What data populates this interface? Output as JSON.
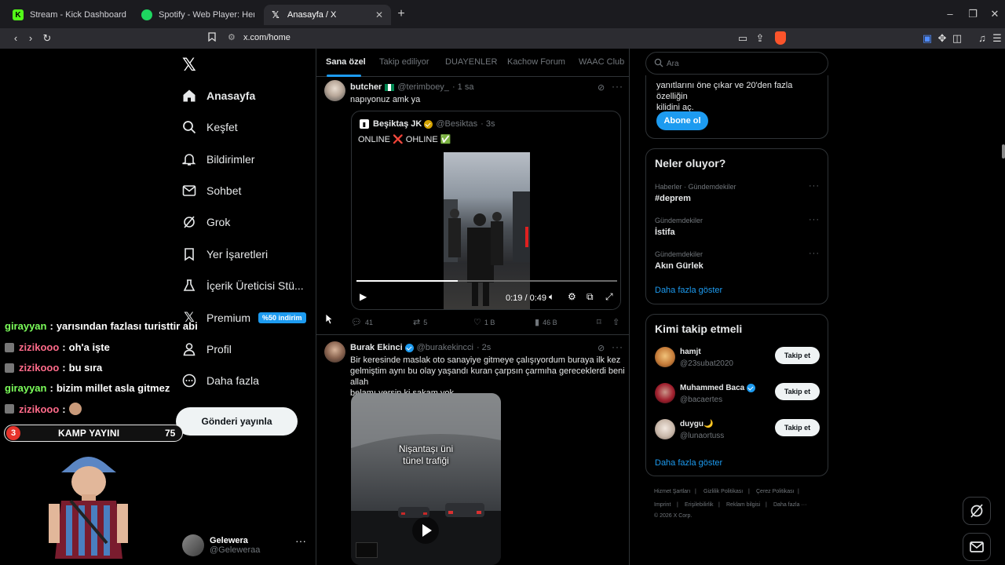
{
  "browser": {
    "tabs": [
      {
        "title": "Stream - Kick Dashboard",
        "icon": "kick-icon",
        "active": false
      },
      {
        "title": "Spotify - Web Player: Herkes için müz",
        "icon": "spotify-icon",
        "active": false
      },
      {
        "title": "Anasayfa / X",
        "icon": "x-icon",
        "active": true
      }
    ],
    "new_tab": "+",
    "url": "x.com/home",
    "colors": {
      "kick": "#53fc18",
      "spotify": "#1ed760",
      "brave": "#fb542b"
    }
  },
  "nav": {
    "items": [
      {
        "label": "Anasayfa",
        "icon": "home-icon",
        "active": true
      },
      {
        "label": "Keşfet",
        "icon": "search-icon"
      },
      {
        "label": "Bildirimler",
        "icon": "bell-icon"
      },
      {
        "label": "Sohbet",
        "icon": "mail-icon"
      },
      {
        "label": "Grok",
        "icon": "grok-icon"
      },
      {
        "label": "Yer İşaretleri",
        "icon": "bookmark-icon"
      },
      {
        "label": "İçerik Üreticisi Stü...",
        "icon": "creator-studio-icon"
      },
      {
        "label": "Premium",
        "icon": "x-icon",
        "badge": "%50 indirim"
      },
      {
        "label": "Profil",
        "icon": "person-icon"
      },
      {
        "label": "Daha fazla",
        "icon": "more-circle-icon"
      }
    ],
    "post_button": "Gönderi yayınla",
    "account": {
      "name": "Gelewera",
      "handle": "@Geleweraa",
      "more": "···"
    }
  },
  "stream_overlay": {
    "chat": [
      {
        "user": "girayyan",
        "message": "yarısından fazlası turisttir abi",
        "color": "green",
        "emote": false
      },
      {
        "user": "zizikooo",
        "message": "oh'a işte",
        "color": "pink",
        "emote": true
      },
      {
        "user": "zizikooo",
        "message": "bu sıra",
        "color": "pink",
        "emote": true
      },
      {
        "user": "girayyan",
        "message": "bizim millet asla gitmez",
        "color": "green",
        "emote": false
      },
      {
        "user": "zizikooo",
        "message": "",
        "color": "pink",
        "emote": true
      }
    ],
    "kamp": {
      "left": "3",
      "title": "KAMP YAYINI",
      "right": "75"
    }
  },
  "feed": {
    "tabs": [
      "Sana özel",
      "Takip ediliyor",
      "DUAYENLER",
      "Kachow Forum",
      "WAAC Club"
    ],
    "posts": [
      {
        "name": "butcher",
        "handle": "@terimboey_",
        "time": "· 1 sa",
        "text": "napıyonuz amk ya",
        "quote": {
          "name": "Beşiktaş JK",
          "handle": "@Besiktas",
          "time": "· 3s",
          "text": "ONLINE ❌ OHLINE ✅",
          "video_time": "0:19 / 0:49",
          "video_progress": 0.39
        },
        "actions": {
          "replies": "41",
          "reposts": "5",
          "likes": "1 B",
          "views": "46 B"
        }
      },
      {
        "name": "Burak Ekinci",
        "handle": "@burakekincci",
        "time": "· 2s",
        "text": [
          "Bir keresinde maslak oto sanayiye gitmeye çalışıyordum buraya ilk kez",
          "gelmiştim aynı bu olay yaşandı kuran çarpsın çarmıha gereceklerdi beni allah",
          "belamı versin ki şakam yok"
        ],
        "media_caption": [
          "Nişantaşı üni",
          "tünel trafiği"
        ]
      }
    ]
  },
  "right": {
    "search_placeholder": "Ara",
    "premium": {
      "text": [
        "yanıtlarını öne çıkar ve 20'den fazla özelliğin",
        "kilidini aç."
      ],
      "button": "Abone ol"
    },
    "trends": {
      "title": "Neler oluyor?",
      "items": [
        {
          "category": "Haberler · Gündemdekiler",
          "name": "#deprem"
        },
        {
          "category": "Gündemdekiler",
          "name": "İstifa"
        },
        {
          "category": "Gündemdekiler",
          "name": "Akın Gürlek"
        }
      ],
      "show_more": "Daha fazla göster"
    },
    "who_to_follow": {
      "title": "Kimi takip etmeli",
      "items": [
        {
          "name": "hamjt",
          "handle": "@23subat2020",
          "verified": false,
          "emoji": ""
        },
        {
          "name": "Muhammed Baca",
          "handle": "@bacaertes",
          "verified": true,
          "emoji": ""
        },
        {
          "name": "duygu",
          "handle": "@lunaortuss",
          "verified": false,
          "emoji": "🌙"
        }
      ],
      "button": "Takip et",
      "show_more": "Daha fazla göster"
    },
    "footer": {
      "row1": [
        "Hizmet Şartları",
        "|",
        "Gizlilik Politikası",
        "|",
        "Çerez Politikası",
        "|"
      ],
      "row2": [
        "Imprint",
        "|",
        "Erişilebilirlik",
        "|",
        "Reklam bilgisi",
        "|",
        "Daha fazla ···"
      ],
      "row3": "© 2026 X Corp."
    }
  },
  "colors": {
    "accent": "#1d9bf0",
    "background": "#000000",
    "border": "#2f3336",
    "muted": "#71767b"
  }
}
